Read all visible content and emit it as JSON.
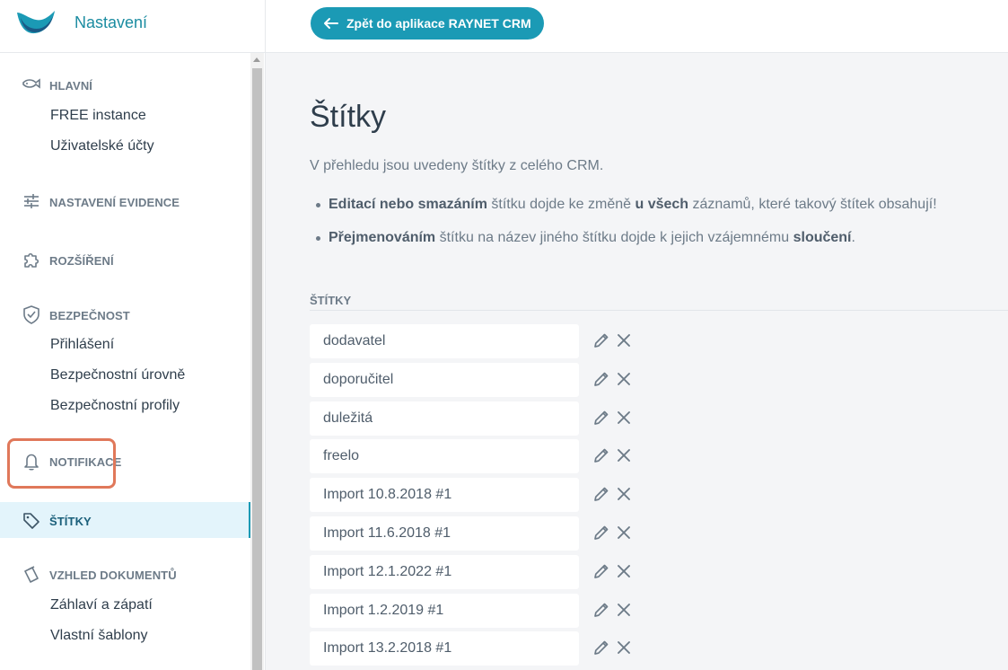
{
  "brand": {
    "title": "Nastavení"
  },
  "topbar": {
    "back_label": "Zpět do aplikace RAYNET CRM"
  },
  "sidebar": {
    "sections": [
      {
        "id": "hlavni",
        "label": "HLAVNÍ",
        "icon": "fish-icon",
        "items": [
          "FREE instance",
          "Uživatelské účty"
        ]
      },
      {
        "id": "evidence",
        "label": "NASTAVENÍ EVIDENCE",
        "icon": "sliders-icon",
        "items": []
      },
      {
        "id": "rozsireni",
        "label": "ROZŠÍŘENÍ",
        "icon": "puzzle-icon",
        "items": []
      },
      {
        "id": "bezpecnost",
        "label": "BEZPEČNOST",
        "icon": "shield-check-icon",
        "items": [
          "Přihlášení",
          "Bezpečnostní úrovně",
          "Bezpečnostní profily"
        ]
      },
      {
        "id": "notifikace",
        "label": "NOTIFIKACE",
        "icon": "bell-icon",
        "items": []
      },
      {
        "id": "stitky",
        "label": "ŠTÍTKY",
        "icon": "tag-icon",
        "items": [],
        "active": true
      },
      {
        "id": "dokumenty",
        "label": "VZHLED DOKUMENTŮ",
        "icon": "documents-icon",
        "items": [
          "Záhlaví a zápatí",
          "Vlastní šablony"
        ]
      }
    ]
  },
  "main": {
    "title": "Štítky",
    "intro": "V přehledu jsou uvedeny štítky z celého CRM.",
    "bullet1": {
      "b1": "Editací nebo smazáním",
      "t1": " štítku dojde ke změně ",
      "b2": "u všech",
      "t2": " záznamů, které takový štítek obsahují!"
    },
    "bullet2": {
      "b1": "Přejmenováním",
      "t1": " štítku na název jiného štítku dojde k jejich vzájemnému ",
      "b2": "sloučení",
      "t2": "."
    },
    "tags_heading": "ŠTÍTKY",
    "tags": [
      "dodavatel",
      "doporučitel",
      "duležitá",
      "freelo",
      "Import 10.8.2018 #1",
      "Import 11.6.2018 #1",
      "Import 12.1.2022 #1",
      "Import 1.2.2019 #1",
      "Import 13.2.2018 #1"
    ]
  },
  "colors": {
    "accent": "#1b9ab5",
    "brand_text": "#1b8ca1",
    "highlight": "#e0785a",
    "active_bg": "#e3f4fb"
  }
}
